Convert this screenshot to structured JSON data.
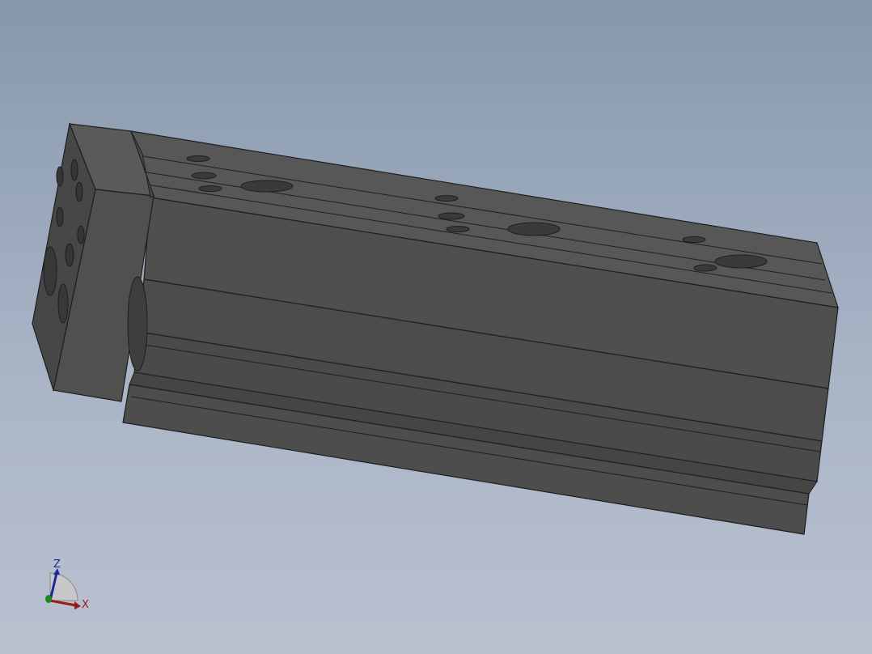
{
  "viewport": {
    "background_top": "#8797ab",
    "background_bottom": "#b9c1cf"
  },
  "model": {
    "body_color": "#4f4f4f",
    "edge_color": "#1e1e1e",
    "top_face_color": "#575757",
    "end_face_color": "#4a4a4a"
  },
  "triad": {
    "z_label": "Z",
    "x_label": "X",
    "z_color": "#1a2a9a",
    "x_color": "#9a1a1a",
    "y_color": "#1a8a1a"
  }
}
